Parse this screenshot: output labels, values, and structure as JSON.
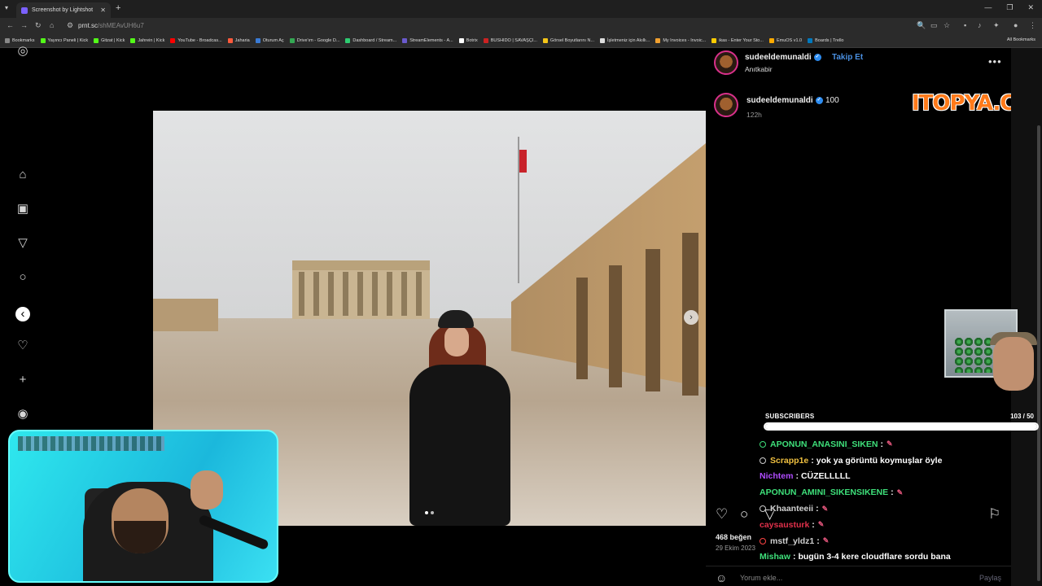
{
  "browser": {
    "tab_title": "Screenshot by Lightshot",
    "url_host": "prnt.sc",
    "url_path": "/shMEAvUH6u7",
    "bookmarks": [
      {
        "label": "Bookmarks",
        "color": "#888888"
      },
      {
        "label": "Yayıncı Paneli | Kick",
        "color": "#53fc18"
      },
      {
        "label": "Gitzat | Kick",
        "color": "#53fc18"
      },
      {
        "label": "Jahrein | Kick",
        "color": "#53fc18"
      },
      {
        "label": "YouTube - Broadcas...",
        "color": "#ff0000"
      },
      {
        "label": "Jaharia",
        "color": "#ff5a3c"
      },
      {
        "label": "Oturum Aç",
        "color": "#3a7bd5"
      },
      {
        "label": "Drive'ım - Google D...",
        "color": "#34a853"
      },
      {
        "label": "Dashboard / Stream...",
        "color": "#2ecc71"
      },
      {
        "label": "StreamElements - A...",
        "color": "#6a5acd"
      },
      {
        "label": "Botrix",
        "color": "#ffffff"
      },
      {
        "label": "BUSHIDO | SAVAŞÇI...",
        "color": "#cc2222"
      },
      {
        "label": "Görsel Boyutlarını N...",
        "color": "#f5c518"
      },
      {
        "label": "İşletmeniz için Akıllı...",
        "color": "#dddddd"
      },
      {
        "label": "My Invoices - Invoic...",
        "color": "#f0a030"
      },
      {
        "label": "ikas - Enter Your Sto...",
        "color": "#ffcc00"
      },
      {
        "label": "EmuOS v1.0",
        "color": "#ffaa00"
      },
      {
        "label": "Boards | Trello",
        "color": "#0079bf"
      }
    ],
    "all_bookmarks": "All Bookmarks"
  },
  "post": {
    "username": "sudeeldemunaldi",
    "follow_label": "Takip Et",
    "location": "Anıtkabir",
    "comment_user": "sudeeldemunaldi",
    "comment_text": "100",
    "comment_time": "122h",
    "likes": "468 beğen",
    "date": "29 Ekim 2023",
    "comment_placeholder": "Yorum ekle...",
    "share_label": "Paylaş",
    "carousel_index": 1,
    "carousel_count": 2
  },
  "watermark": "ITOPYA.COM",
  "stream": {
    "subgoal_label": "SUBSCRIBERS",
    "subgoal_count": "103  / 50",
    "subgoal_progress": 1.0,
    "chat": [
      {
        "nick": "APONUN_ANASINI_SIKEN",
        "color": "#3ee07a",
        "text": "",
        "emoji": true,
        "badge": "#3ee07a"
      },
      {
        "nick": "Scrapp1e",
        "color": "#f0c040",
        "text": "yok ya görüntü koymuşlar öyle",
        "emoji": false,
        "badge": "#cccccc"
      },
      {
        "nick": "Nichtem",
        "color": "#b04cff",
        "text": "CÜZELLLLL",
        "emoji": false,
        "badge": ""
      },
      {
        "nick": "APONUN_AMINI_SIKENSIKENE",
        "color": "#3ee07a",
        "text": "",
        "emoji": true,
        "badge": ""
      },
      {
        "nick": "Khaanteeii",
        "color": "#d0d0d0",
        "text": "",
        "emoji": true,
        "badge": "#cccccc"
      },
      {
        "nick": "caysausturk",
        "color": "#e0304a",
        "text": "",
        "emoji": true,
        "badge": ""
      },
      {
        "nick": "mstf_yldz1",
        "color": "#d0d0d0",
        "text": "",
        "emoji": true,
        "badge": "#ff4444"
      },
      {
        "nick": "Mishaw",
        "color": "#3ee07a",
        "text": "bugün 3-4 kere cloudflare sordu bana",
        "emoji": false,
        "badge": ""
      }
    ]
  },
  "icons": {
    "home": "home-icon",
    "reels": "reels-icon",
    "explore": "explore-icon",
    "search": "search-icon",
    "heart": "heart-icon",
    "create": "plus-icon",
    "threads": "threads-icon"
  }
}
